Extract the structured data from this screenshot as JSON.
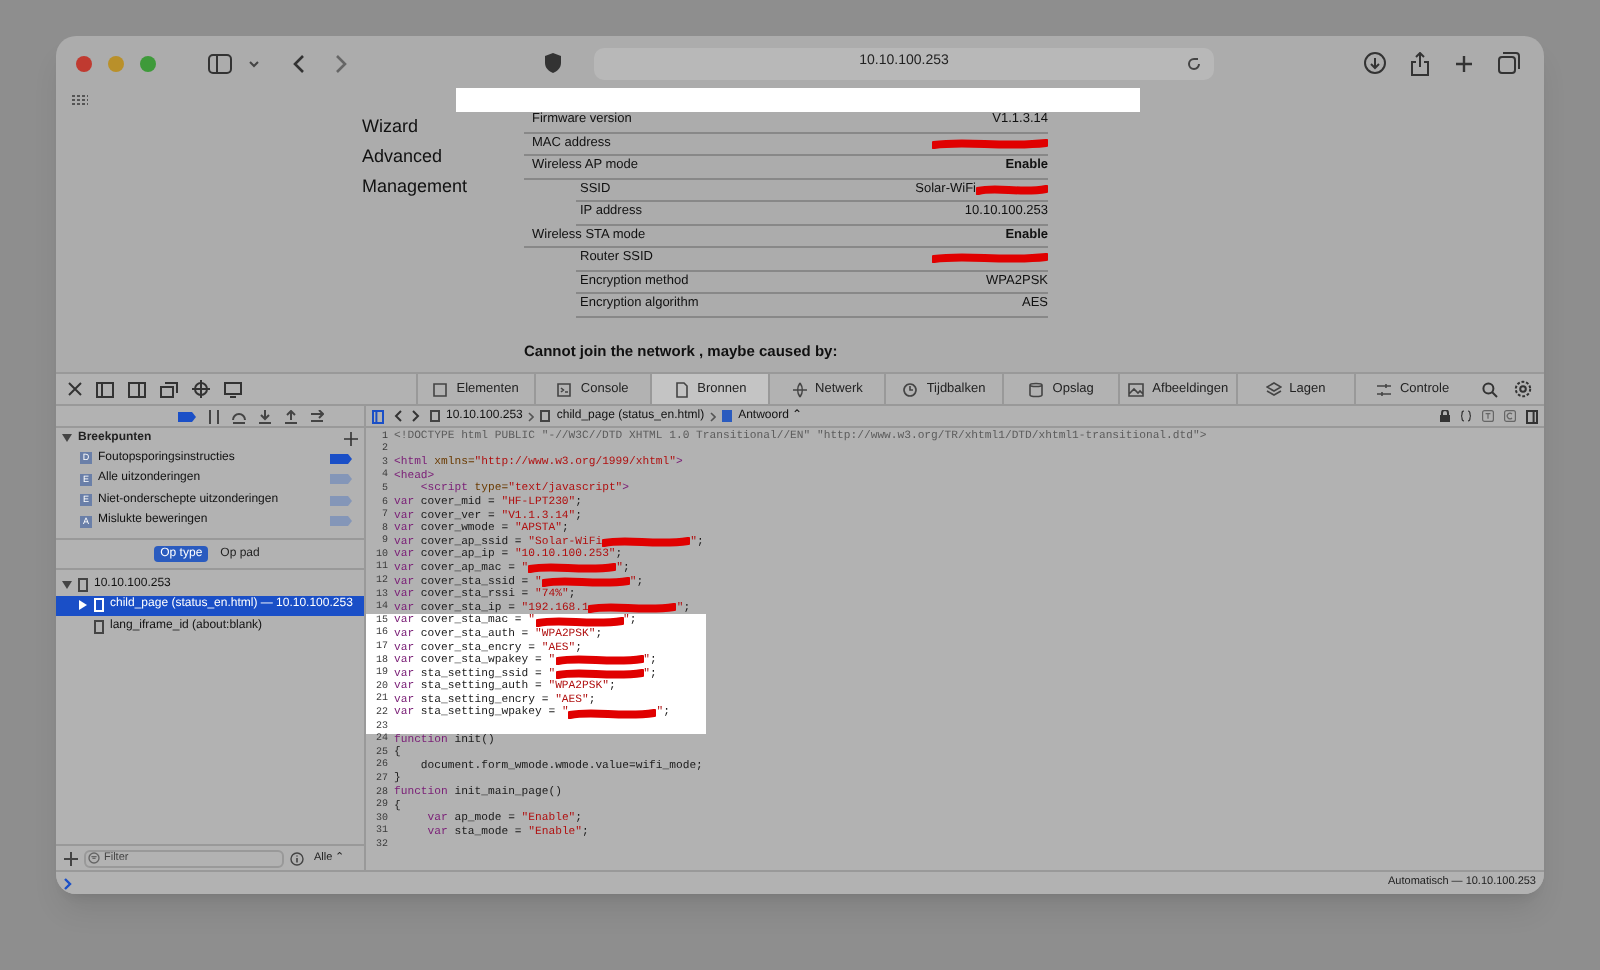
{
  "browser": {
    "address": "10.10.100.253"
  },
  "page": {
    "nav": [
      "Wizard",
      "Advanced",
      "Management"
    ],
    "rows": [
      {
        "label": "Firmware version",
        "value": "V1.1.3.14",
        "indent": false,
        "bold": false,
        "redacted": false
      },
      {
        "label": "MAC address",
        "indent": false,
        "redacted": true
      },
      {
        "label": "Wireless AP mode",
        "value": "Enable",
        "indent": false,
        "bold": true,
        "redacted": false
      },
      {
        "label": "SSID",
        "value": "Solar-WiFi",
        "indent": true,
        "bold": false,
        "redacted": true
      },
      {
        "label": "IP address",
        "value": "10.10.100.253",
        "indent": true,
        "bold": false,
        "redacted": false
      },
      {
        "label": "Wireless STA mode",
        "value": "Enable",
        "indent": false,
        "bold": true,
        "redacted": false
      },
      {
        "label": "Router SSID",
        "indent": true,
        "redacted": true
      },
      {
        "label": "Encryption method",
        "value": "WPA2PSK",
        "indent": true,
        "bold": false,
        "redacted": false
      },
      {
        "label": "Encryption algorithm",
        "value": "AES",
        "indent": true,
        "bold": false,
        "redacted": false
      }
    ],
    "footer": "Cannot join the network , maybe caused by:"
  },
  "devtools": {
    "tabs": [
      {
        "label": "Elementen",
        "selected": false
      },
      {
        "label": "Console",
        "selected": false
      },
      {
        "label": "Bronnen",
        "selected": true
      },
      {
        "label": "Netwerk",
        "selected": false
      },
      {
        "label": "Tijdbalken",
        "selected": false
      },
      {
        "label": "Opslag",
        "selected": false
      },
      {
        "label": "Afbeeldingen",
        "selected": false
      },
      {
        "label": "Lagen",
        "selected": false
      },
      {
        "label": "Controle",
        "selected": false
      }
    ],
    "breadcrumb": [
      "10.10.100.253",
      "child_page (status_en.html)",
      "Antwoord ⌃"
    ],
    "breakpoints": {
      "title": "Breekpunten",
      "items": [
        {
          "badge": "D",
          "label": "Foutopsporingsinstructies",
          "enabled": true
        },
        {
          "badge": "E",
          "label": "Alle uitzonderingen",
          "enabled": false
        },
        {
          "badge": "E",
          "label": "Niet-onderschepte uitzonderingen",
          "enabled": false
        },
        {
          "badge": "A",
          "label": "Mislukte beweringen",
          "enabled": false
        }
      ]
    },
    "grouping": [
      {
        "label": "Op type",
        "selected": true
      },
      {
        "label": "Op pad",
        "selected": false
      }
    ],
    "tree": [
      {
        "label": "10.10.100.253",
        "expanded": true,
        "selected": false,
        "children": [
          {
            "label": "child_page (status_en.html) — 10.10.100.253",
            "selected": true,
            "expanded": false
          },
          {
            "label": "lang_iframe_id (about:blank)",
            "selected": false
          }
        ]
      }
    ],
    "filter": {
      "placeholder": "Filter"
    },
    "scope": "Alle ⌃",
    "context": "Automatisch — 10.10.100.253",
    "code": [
      {
        "n": "1",
        "highlighted": false,
        "segs": [
          {
            "kind": "doctype",
            "text": "<!DOCTYPE html PUBLIC \"-//W3C//DTD XHTML 1.0 Transitional//EN\" \"http://www.w3.org/TR/xhtml1/DTD/xhtml1-transitional.dtd\">"
          }
        ]
      },
      {
        "n": "2",
        "highlighted": false
      },
      {
        "n": "3",
        "highlighted": false,
        "segs": [
          {
            "kind": "tag",
            "text": "<html"
          },
          {
            "kind": "attr",
            "text": " xmlns="
          },
          {
            "kind": "string",
            "text": "\"http://www.w3.org/1999/xhtml\""
          },
          {
            "kind": "tag",
            "text": ">"
          }
        ]
      },
      {
        "n": "4",
        "highlighted": false,
        "segs": [
          {
            "kind": "tag",
            "text": "<head>"
          }
        ]
      },
      {
        "n": "5",
        "highlighted": false,
        "segs": [
          {
            "kind": "tag",
            "text": "    <script"
          },
          {
            "kind": "attr",
            "text": " type="
          },
          {
            "kind": "string",
            "text": "\"text/javascript\""
          },
          {
            "kind": "tag",
            "text": ">"
          }
        ]
      },
      {
        "n": "6",
        "highlighted": false,
        "segs": [
          {
            "kind": "keyword",
            "text": "var"
          },
          {
            "kind": "plain",
            "text": " cover_mid = "
          },
          {
            "kind": "string",
            "text": "\"HF-LPT230\""
          },
          {
            "kind": "plain",
            "text": ";"
          }
        ]
      },
      {
        "n": "7",
        "highlighted": false,
        "segs": [
          {
            "kind": "keyword",
            "text": "var"
          },
          {
            "kind": "plain",
            "text": " cover_ver = "
          },
          {
            "kind": "string",
            "text": "\"V1.1.3.14\""
          },
          {
            "kind": "plain",
            "text": ";"
          }
        ]
      },
      {
        "n": "8",
        "highlighted": false,
        "segs": [
          {
            "kind": "keyword",
            "text": "var"
          },
          {
            "kind": "plain",
            "text": " cover_wmode = "
          },
          {
            "kind": "string",
            "text": "\"APSTA\""
          },
          {
            "kind": "plain",
            "text": ";"
          }
        ]
      },
      {
        "n": "9",
        "highlighted": false,
        "segs": [
          {
            "kind": "keyword",
            "text": "var"
          },
          {
            "kind": "plain",
            "text": " cover_ap_ssid = "
          },
          {
            "kind": "string",
            "text": "\"Solar-WiFi"
          },
          {
            "kind": "redacted"
          },
          {
            "kind": "string",
            "text": "\""
          },
          {
            "kind": "plain",
            "text": ";"
          }
        ]
      },
      {
        "n": "10",
        "highlighted": false,
        "segs": [
          {
            "kind": "keyword",
            "text": "var"
          },
          {
            "kind": "plain",
            "text": " cover_ap_ip = "
          },
          {
            "kind": "string",
            "text": "\"10.10.100.253\""
          },
          {
            "kind": "plain",
            "text": ";"
          }
        ]
      },
      {
        "n": "11",
        "highlighted": false,
        "segs": [
          {
            "kind": "keyword",
            "text": "var"
          },
          {
            "kind": "plain",
            "text": " cover_ap_mac = "
          },
          {
            "kind": "string",
            "text": "\""
          },
          {
            "kind": "redacted"
          },
          {
            "kind": "string",
            "text": "\""
          },
          {
            "kind": "plain",
            "text": ";"
          }
        ]
      },
      {
        "n": "12",
        "highlighted": false,
        "segs": [
          {
            "kind": "keyword",
            "text": "var"
          },
          {
            "kind": "plain",
            "text": " cover_sta_ssid = "
          },
          {
            "kind": "string",
            "text": "\""
          },
          {
            "kind": "redacted"
          },
          {
            "kind": "string",
            "text": "\""
          },
          {
            "kind": "plain",
            "text": ";"
          }
        ]
      },
      {
        "n": "13",
        "highlighted": false,
        "segs": [
          {
            "kind": "keyword",
            "text": "var"
          },
          {
            "kind": "plain",
            "text": " cover_sta_rssi = "
          },
          {
            "kind": "string",
            "text": "\"74%\""
          },
          {
            "kind": "plain",
            "text": ";"
          }
        ]
      },
      {
        "n": "14",
        "highlighted": false,
        "segs": [
          {
            "kind": "keyword",
            "text": "var"
          },
          {
            "kind": "plain",
            "text": " cover_sta_ip = "
          },
          {
            "kind": "string",
            "text": "\"192.168.1"
          },
          {
            "kind": "redacted"
          },
          {
            "kind": "string",
            "text": "\""
          },
          {
            "kind": "plain",
            "text": ";"
          }
        ]
      },
      {
        "n": "15",
        "highlighted": true,
        "segs": [
          {
            "kind": "keyword",
            "text": "var"
          },
          {
            "kind": "plain",
            "text": " cover_sta_mac = "
          },
          {
            "kind": "string",
            "text": "\""
          },
          {
            "kind": "redacted"
          },
          {
            "kind": "string",
            "text": "\""
          },
          {
            "kind": "plain",
            "text": ";"
          }
        ]
      },
      {
        "n": "16",
        "highlighted": true,
        "segs": [
          {
            "kind": "keyword",
            "text": "var"
          },
          {
            "kind": "plain",
            "text": " cover_sta_auth = "
          },
          {
            "kind": "string",
            "text": "\"WPA2PSK\""
          },
          {
            "kind": "plain",
            "text": ";"
          }
        ]
      },
      {
        "n": "17",
        "highlighted": true,
        "segs": [
          {
            "kind": "keyword",
            "text": "var"
          },
          {
            "kind": "plain",
            "text": " cover_sta_encry = "
          },
          {
            "kind": "string",
            "text": "\"AES\""
          },
          {
            "kind": "plain",
            "text": ";"
          }
        ]
      },
      {
        "n": "18",
        "highlighted": true,
        "segs": [
          {
            "kind": "keyword",
            "text": "var"
          },
          {
            "kind": "plain",
            "text": " cover_sta_wpakey = "
          },
          {
            "kind": "string",
            "text": "\""
          },
          {
            "kind": "redacted"
          },
          {
            "kind": "string",
            "text": "\""
          },
          {
            "kind": "plain",
            "text": ";"
          }
        ]
      },
      {
        "n": "19",
        "highlighted": true,
        "segs": [
          {
            "kind": "keyword",
            "text": "var"
          },
          {
            "kind": "plain",
            "text": " sta_setting_ssid = "
          },
          {
            "kind": "string",
            "text": "\""
          },
          {
            "kind": "redacted"
          },
          {
            "kind": "string",
            "text": "\""
          },
          {
            "kind": "plain",
            "text": ";"
          }
        ]
      },
      {
        "n": "20",
        "highlighted": true,
        "segs": [
          {
            "kind": "keyword",
            "text": "var"
          },
          {
            "kind": "plain",
            "text": " sta_setting_auth = "
          },
          {
            "kind": "string",
            "text": "\"WPA2PSK\""
          },
          {
            "kind": "plain",
            "text": ";"
          }
        ]
      },
      {
        "n": "21",
        "highlighted": true,
        "segs": [
          {
            "kind": "keyword",
            "text": "var"
          },
          {
            "kind": "plain",
            "text": " sta_setting_encry = "
          },
          {
            "kind": "string",
            "text": "\"AES\""
          },
          {
            "kind": "plain",
            "text": ";"
          }
        ]
      },
      {
        "n": "22",
        "highlighted": true,
        "segs": [
          {
            "kind": "keyword",
            "text": "var"
          },
          {
            "kind": "plain",
            "text": " sta_setting_wpakey = "
          },
          {
            "kind": "string",
            "text": "\""
          },
          {
            "kind": "redacted"
          },
          {
            "kind": "string",
            "text": "\""
          },
          {
            "kind": "plain",
            "text": ";"
          }
        ]
      },
      {
        "n": "23",
        "highlighted": true
      },
      {
        "n": "24",
        "highlighted": false,
        "segs": [
          {
            "kind": "keyword",
            "text": "function"
          },
          {
            "kind": "plain",
            "text": " init()"
          }
        ]
      },
      {
        "n": "25",
        "highlighted": false,
        "segs": [
          {
            "kind": "plain",
            "text": "{"
          }
        ]
      },
      {
        "n": "26",
        "highlighted": false,
        "segs": [
          {
            "kind": "plain",
            "text": "    document.form_wmode.wmode.value=wifi_mode;"
          }
        ]
      },
      {
        "n": "27",
        "highlighted": false,
        "segs": [
          {
            "kind": "plain",
            "text": "}"
          }
        ]
      },
      {
        "n": "28",
        "highlighted": false,
        "segs": [
          {
            "kind": "keyword",
            "text": "function"
          },
          {
            "kind": "plain",
            "text": " init_main_page()"
          }
        ]
      },
      {
        "n": "29",
        "highlighted": false,
        "segs": [
          {
            "kind": "plain",
            "text": "{"
          }
        ]
      },
      {
        "n": "30",
        "highlighted": false,
        "segs": [
          {
            "kind": "keyword",
            "text": "     var"
          },
          {
            "kind": "plain",
            "text": " ap_mode = "
          },
          {
            "kind": "string",
            "text": "\"Enable\""
          },
          {
            "kind": "plain",
            "text": ";"
          }
        ]
      },
      {
        "n": "31",
        "highlighted": false,
        "segs": [
          {
            "kind": "keyword",
            "text": "     var"
          },
          {
            "kind": "plain",
            "text": " sta_mode = "
          },
          {
            "kind": "string",
            "text": "\"Enable\""
          },
          {
            "kind": "plain",
            "text": ";"
          }
        ]
      },
      {
        "n": "32",
        "highlighted": false
      }
    ]
  }
}
